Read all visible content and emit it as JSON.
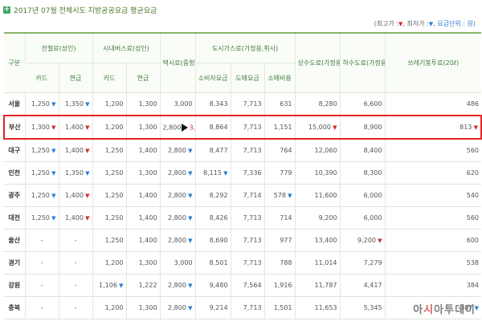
{
  "title": "2017년 07월 전체시도 지방공공요금 평균요금",
  "legend": {
    "max_label": "최고가 :",
    "min_label": "최저가 :",
    "unit_label": "요금단위 : 원"
  },
  "headers": {
    "city": "구분",
    "subway": "전철료(성인)",
    "bus": "시내버스료(성인)",
    "taxi": "택시료(중형)",
    "city_gas": "도시가스료(가정용,취사)",
    "water": "상수도료(가정용)",
    "sewage": "하수도료(가정용)",
    "garbage": "쓰레기봉투료(20ℓ)",
    "card": "카드",
    "cash": "현금",
    "gas_consumer": "소비자요금",
    "gas_wholesale": "도매요금",
    "gas_retail": "소매비용"
  },
  "rows": [
    {
      "city": "서울",
      "subway_card": "1,250",
      "subway_card_m": "dn",
      "subway_cash": "1,350",
      "subway_cash_m": "dn",
      "bus_card": "1,200",
      "bus_cash": "1,300",
      "taxi": "3,000",
      "gas_consumer": "8,343",
      "gas_wholesale": "7,713",
      "gas_retail": "631",
      "water": "8,280",
      "sewage": "6,600",
      "garbage": "486"
    },
    {
      "city": "부산",
      "subway_card": "1,300",
      "subway_card_m": "up",
      "subway_cash": "1,400",
      "subway_cash_m": "up",
      "bus_card": "1,200",
      "bus_cash": "1,300",
      "taxi": "2,800",
      "taxi_new": "3,300",
      "gas_consumer": "8,864",
      "gas_wholesale": "7,713",
      "gas_retail": "1,151",
      "water": "15,000",
      "water_m": "up",
      "sewage": "8,900",
      "garbage": "813",
      "garbage_m": "up",
      "highlight": true
    },
    {
      "city": "대구",
      "subway_card": "1,250",
      "subway_card_m": "dn",
      "subway_cash": "1,400",
      "subway_cash_m": "up",
      "bus_card": "1,250",
      "bus_cash": "1,400",
      "taxi": "2,800",
      "taxi_m": "dn",
      "gas_consumer": "8,477",
      "gas_wholesale": "7,713",
      "gas_retail": "764",
      "water": "12,060",
      "sewage": "8,400",
      "garbage": "560"
    },
    {
      "city": "인천",
      "subway_card": "1,250",
      "subway_card_m": "dn",
      "subway_cash": "1,350",
      "subway_cash_m": "dn",
      "bus_card": "1,250",
      "bus_cash": "1,300",
      "taxi": "2,800",
      "taxi_m": "dn",
      "gas_consumer": "8,115",
      "gas_consumer_m": "dn",
      "gas_wholesale": "7,336",
      "gas_retail": "779",
      "water": "10,390",
      "sewage": "8,300",
      "garbage": "620"
    },
    {
      "city": "광주",
      "subway_card": "1,250",
      "subway_card_m": "dn",
      "subway_cash": "1,400",
      "subway_cash_m": "up",
      "bus_card": "1,250",
      "bus_cash": "1,400",
      "taxi": "2,800",
      "taxi_m": "dn",
      "gas_consumer": "8,292",
      "gas_wholesale": "7,714",
      "gas_retail": "578",
      "gas_retail_m": "dn",
      "water": "11,600",
      "sewage": "6,000",
      "garbage": "540"
    },
    {
      "city": "대전",
      "subway_card": "1,250",
      "subway_card_m": "dn",
      "subway_cash": "1,400",
      "subway_cash_m": "up",
      "bus_card": "1,250",
      "bus_cash": "1,400",
      "taxi": "2,800",
      "taxi_m": "dn",
      "gas_consumer": "8,426",
      "gas_wholesale": "7,713",
      "gas_retail": "714",
      "water": "9,200",
      "sewage": "6,000",
      "garbage": "560"
    },
    {
      "city": "울산",
      "subway_card": "-",
      "subway_cash": "-",
      "bus_card": "1,250",
      "bus_cash": "1,400",
      "taxi": "2,800",
      "taxi_m": "dn",
      "gas_consumer": "8,690",
      "gas_wholesale": "7,713",
      "gas_retail": "977",
      "water": "13,400",
      "sewage": "9,200",
      "sewage_m": "up",
      "garbage": "600"
    },
    {
      "city": "경기",
      "subway_card": "-",
      "subway_cash": "-",
      "bus_card": "1,200",
      "bus_cash": "1,300",
      "taxi": "3,000",
      "gas_consumer": "8,501",
      "gas_wholesale": "7,713",
      "gas_retail": "788",
      "water": "11,014",
      "sewage": "7,279",
      "garbage": "538"
    },
    {
      "city": "강원",
      "subway_card": "-",
      "subway_cash": "-",
      "bus_card": "1,106",
      "bus_card_m": "dn",
      "bus_cash": "1,222",
      "taxi": "2,800",
      "taxi_m": "dn",
      "gas_consumer": "9,480",
      "gas_wholesale": "7,564",
      "gas_retail": "1,916",
      "water": "11,787",
      "sewage": "4,417",
      "garbage": "384"
    },
    {
      "city": "충북",
      "subway_card": "-",
      "subway_cash": "-",
      "bus_card": "1,200",
      "bus_cash": "1,300",
      "taxi": "2,800",
      "taxi_m": "dn",
      "gas_consumer": "9,214",
      "gas_wholesale": "7,713",
      "gas_retail": "1,501",
      "water": "11,653",
      "sewage": "5,345",
      "garbage": "307",
      "garbage_m": "dn"
    }
  ],
  "watermark": "아시아투데이",
  "colors": {
    "up": "#d6282a",
    "down": "#2a7bd6",
    "accent": "#3d7a3d",
    "highlight": "#e52323"
  }
}
